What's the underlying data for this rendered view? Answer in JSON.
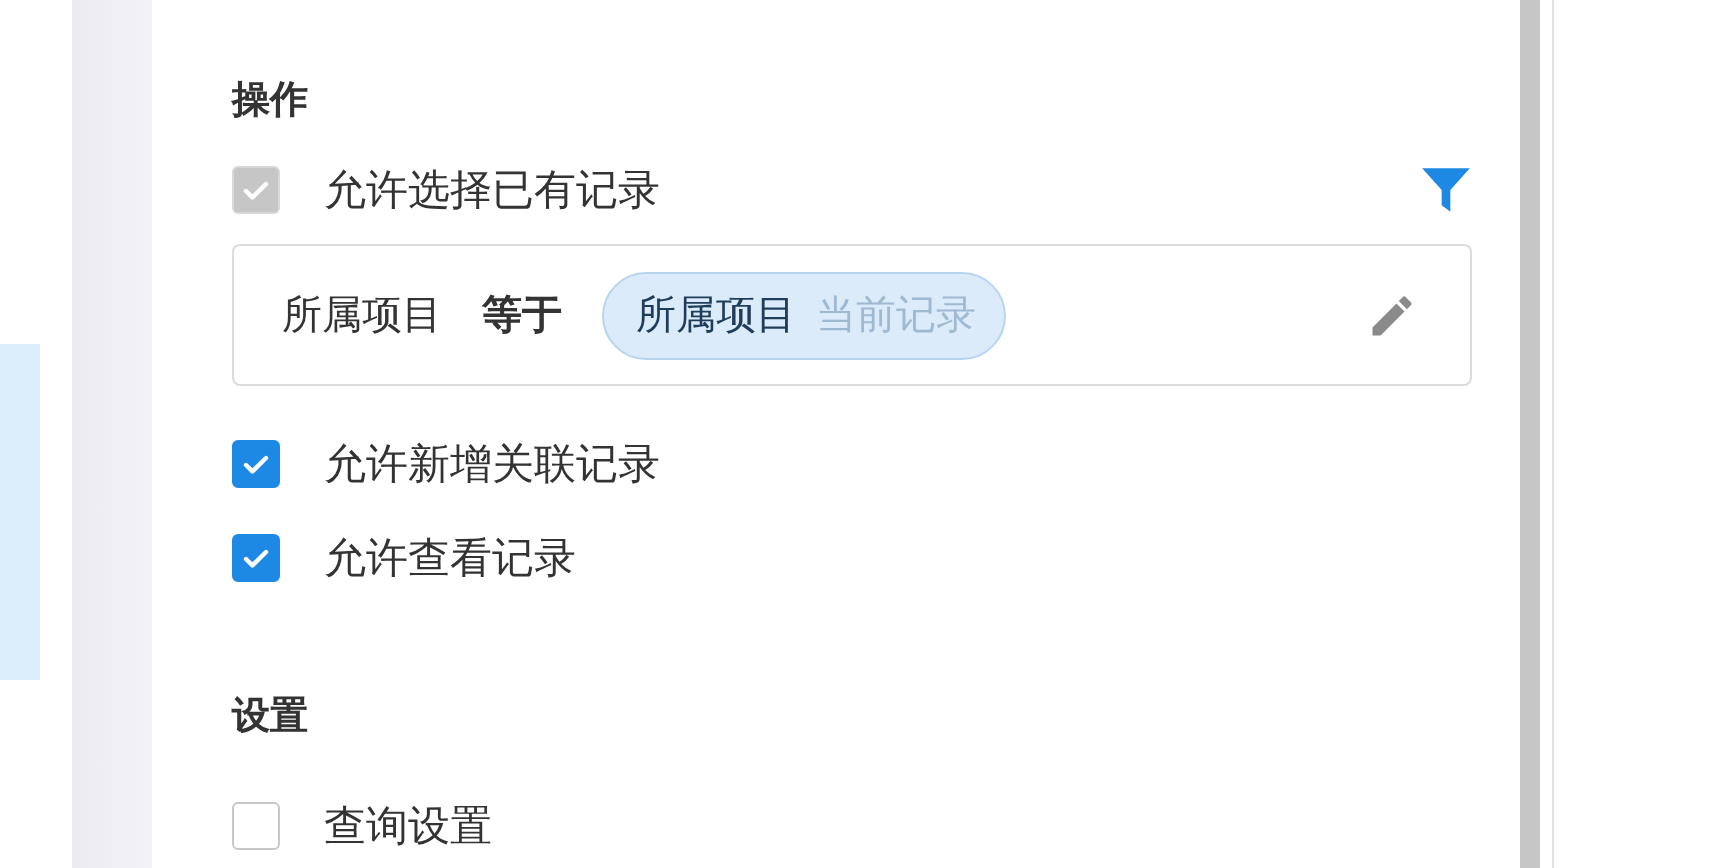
{
  "sections": [
    {
      "title": "操作",
      "items": [
        {
          "kind": "checkbox",
          "label": "允许选择已有记录",
          "checked": true,
          "disabled": true,
          "has_filter": true
        },
        {
          "kind": "condition",
          "field": "所属项目",
          "operator": "等于",
          "value_field": "所属项目",
          "value_source": "当前记录"
        },
        {
          "kind": "checkbox",
          "label": "允许新增关联记录",
          "checked": true,
          "disabled": false
        },
        {
          "kind": "checkbox",
          "label": "允许查看记录",
          "checked": true,
          "disabled": false
        }
      ]
    },
    {
      "title": "设置",
      "items": [
        {
          "kind": "checkbox",
          "label": "查询设置",
          "checked": false,
          "disabled": false
        }
      ]
    }
  ]
}
